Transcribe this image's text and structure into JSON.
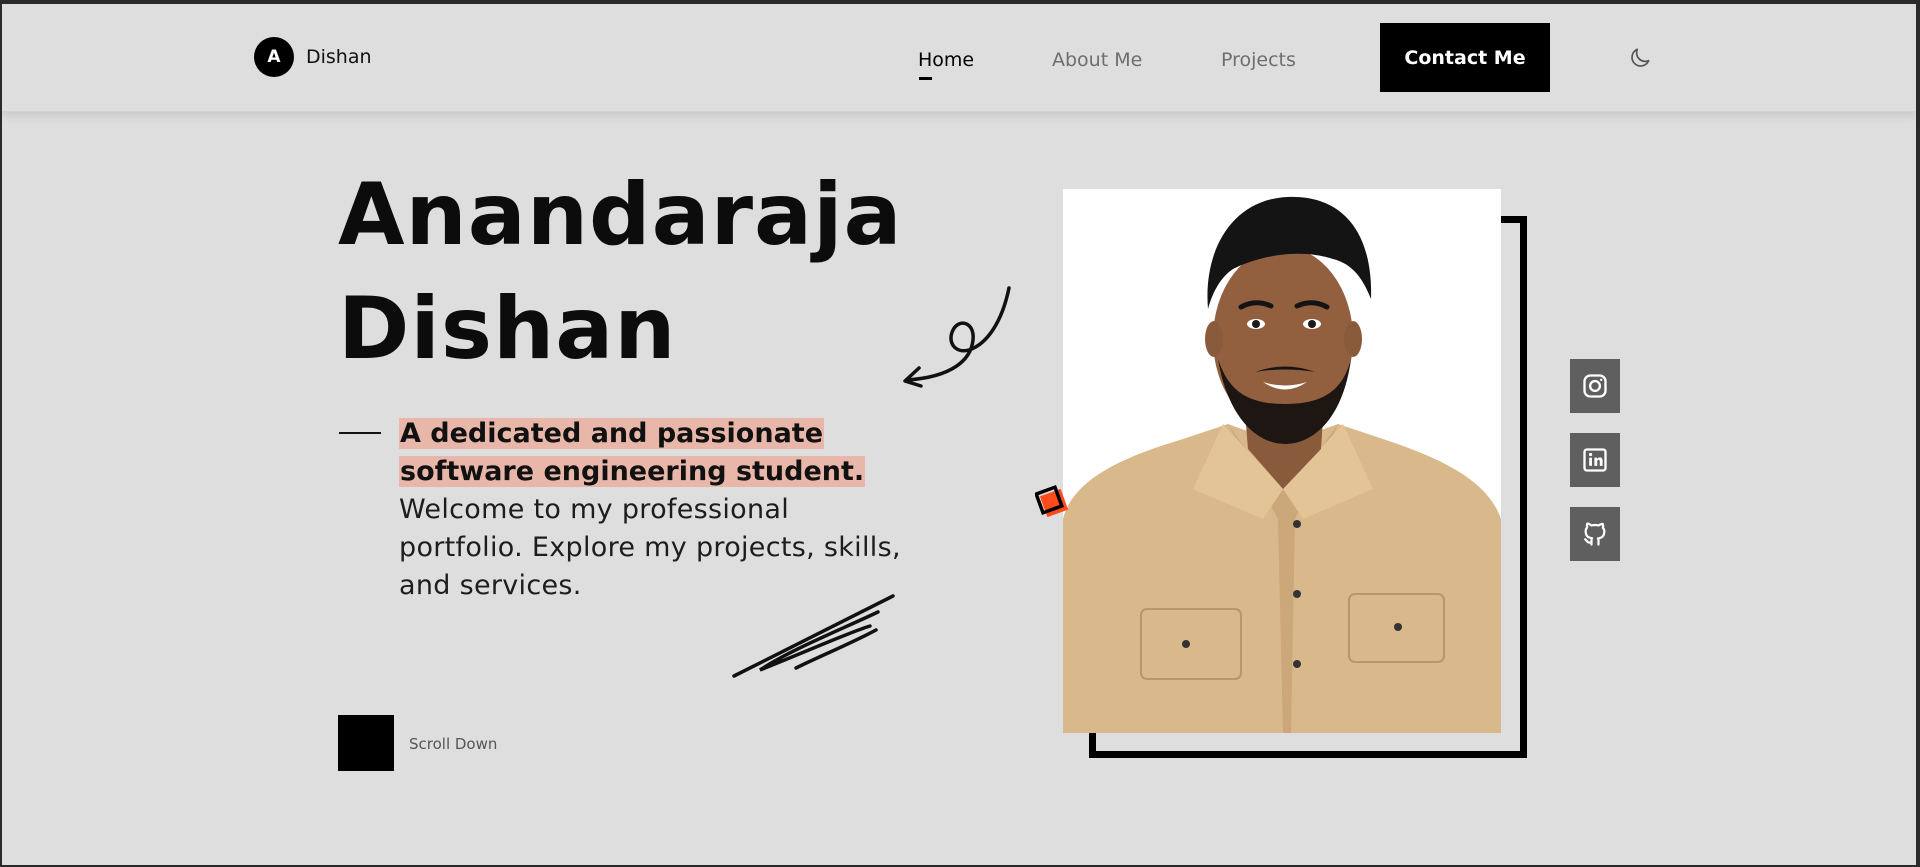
{
  "header": {
    "logo_initial": "A",
    "logo_name": "Dishan",
    "nav": [
      {
        "label": "Home",
        "active": true
      },
      {
        "label": "About Me",
        "active": false
      },
      {
        "label": "Projects",
        "active": false
      }
    ],
    "contact_label": "Contact Me",
    "theme_toggle_icon": "moon-icon"
  },
  "hero": {
    "title_line1": "Anandaraja",
    "title_line2": "Dishan",
    "highlight_line1": "A dedicated and passionate",
    "highlight_line2": "software engineering student.",
    "description_line1": "Welcome to my professional",
    "description_line2": "portfolio. Explore my projects, skills,",
    "description_line3": "and services.",
    "scroll_label": "Scroll Down"
  },
  "socials": [
    {
      "icon": "instagram-icon"
    },
    {
      "icon": "linkedin-icon"
    },
    {
      "icon": "github-icon"
    }
  ],
  "colors": {
    "background": "#dedede",
    "accent_orange": "#ff4a1c",
    "highlight": "#e9b7aa",
    "social_bg": "#5f5f5f",
    "contact_bg": "#000000"
  }
}
